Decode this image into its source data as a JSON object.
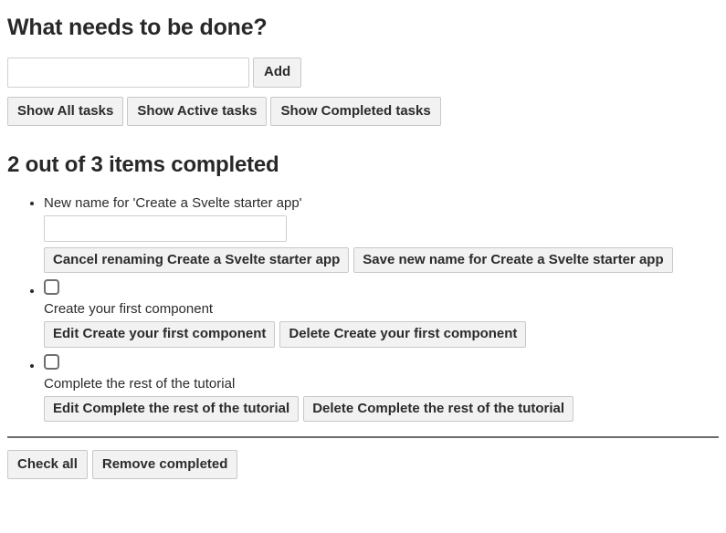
{
  "app": {
    "title": "What needs to be done?"
  },
  "add_form": {
    "input_value": "",
    "input_placeholder": "",
    "add_label": "Add"
  },
  "filters": [
    {
      "label": "Show All tasks",
      "name": "filter-all",
      "pressed": true
    },
    {
      "label": "Show Active tasks",
      "name": "filter-active",
      "pressed": false
    },
    {
      "label": "Show Completed tasks",
      "name": "filter-completed",
      "pressed": false
    }
  ],
  "status": {
    "heading": "2 out of 3 items completed",
    "completed_count": 2,
    "total_count": 3
  },
  "todos": [
    {
      "id": "todo-1",
      "name": "Create a Svelte starter app",
      "editing": true,
      "completed": true,
      "edit_label": "New name for 'Create a Svelte starter app'",
      "edit_value": "",
      "cancel_label": "Cancel renaming Create a Svelte starter app",
      "save_label": "Save new name for Create a Svelte starter app"
    },
    {
      "id": "todo-2",
      "name": "Create your first component",
      "editing": false,
      "completed": false,
      "edit_button_label": "Edit Create your first component",
      "delete_button_label": "Delete Create your first component"
    },
    {
      "id": "todo-3",
      "name": "Complete the rest of the tutorial",
      "editing": false,
      "completed": false,
      "edit_button_label": "Edit Complete the rest of the tutorial",
      "delete_button_label": "Delete Complete the rest of the tutorial"
    }
  ],
  "footer": {
    "check_all_label": "Check all",
    "remove_completed_label": "Remove completed"
  },
  "colors": {
    "text": "#2b2b2b",
    "button_bg": "#f2f2f2",
    "button_border": "#c8c8c8",
    "input_border": "#cfcfcf",
    "divider": "#6b6b6b",
    "page_bg": "#ffffff"
  }
}
